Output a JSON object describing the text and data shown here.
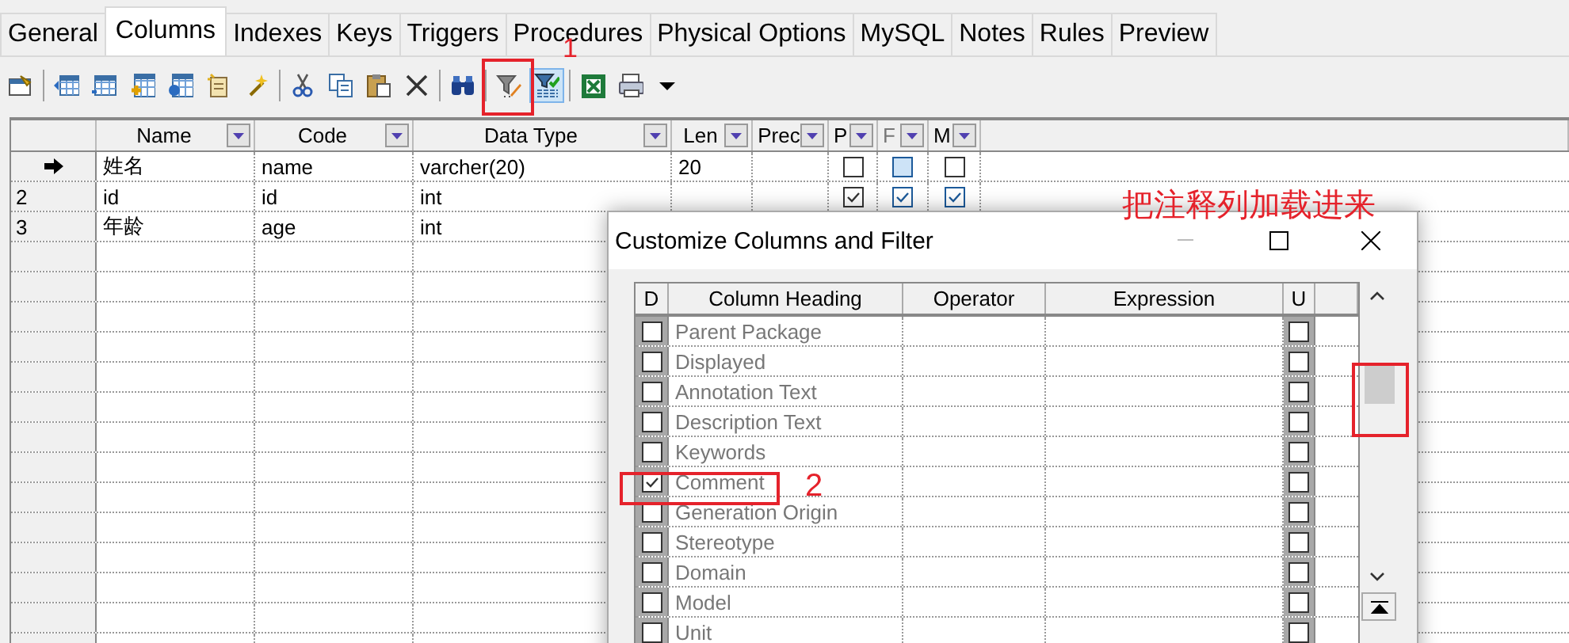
{
  "tabs": [
    {
      "label": "General",
      "selected": false
    },
    {
      "label": "Columns",
      "selected": true
    },
    {
      "label": "Indexes",
      "selected": false
    },
    {
      "label": "Keys",
      "selected": false
    },
    {
      "label": "Triggers",
      "selected": false
    },
    {
      "label": "Procedures",
      "selected": false
    },
    {
      "label": "Physical Options",
      "selected": false
    },
    {
      "label": "MySQL",
      "selected": false
    },
    {
      "label": "Notes",
      "selected": false
    },
    {
      "label": "Rules",
      "selected": false
    },
    {
      "label": "Preview",
      "selected": false
    }
  ],
  "toolbar": [
    {
      "kind": "properties",
      "pressed": false
    },
    {
      "kind": "separator"
    },
    {
      "kind": "insert-row",
      "pressed": false
    },
    {
      "kind": "add-row",
      "pressed": false
    },
    {
      "kind": "add-columns",
      "pressed": false
    },
    {
      "kind": "reuse-columns",
      "pressed": false
    },
    {
      "kind": "new-sheet",
      "pressed": false
    },
    {
      "kind": "wand",
      "pressed": false
    },
    {
      "kind": "separator"
    },
    {
      "kind": "cut",
      "pressed": false
    },
    {
      "kind": "copy",
      "pressed": false
    },
    {
      "kind": "paste",
      "pressed": false
    },
    {
      "kind": "delete",
      "pressed": false
    },
    {
      "kind": "separator"
    },
    {
      "kind": "find",
      "pressed": false
    },
    {
      "kind": "separator"
    },
    {
      "kind": "filter-edit",
      "pressed": false
    },
    {
      "kind": "filter-check",
      "pressed": true
    },
    {
      "kind": "separator"
    },
    {
      "kind": "excel",
      "pressed": false
    },
    {
      "kind": "print",
      "pressed": false
    },
    {
      "kind": "dropdown",
      "pressed": false
    }
  ],
  "grid": {
    "columns": [
      {
        "title": "Name",
        "kind": "text",
        "disabled": false
      },
      {
        "title": "Code",
        "kind": "text",
        "disabled": false
      },
      {
        "title": "Data Type",
        "kind": "text",
        "disabled": false
      },
      {
        "title": "Len",
        "kind": "text",
        "disabled": false
      },
      {
        "title": "Prec",
        "kind": "text",
        "disabled": false
      },
      {
        "title": "P",
        "kind": "check",
        "disabled": false
      },
      {
        "title": "F",
        "kind": "check",
        "disabled": true
      },
      {
        "title": "M",
        "kind": "check",
        "disabled": false
      }
    ],
    "rows": [
      {
        "number": "",
        "current": true,
        "cells": [
          "姓名",
          "name",
          "varcher(20)",
          "20",
          "",
          false,
          false,
          false
        ]
      },
      {
        "number": "2",
        "current": false,
        "cells": [
          "id",
          "id",
          "int",
          "",
          "",
          true,
          true,
          true
        ]
      },
      {
        "number": "3",
        "current": false,
        "cells": [
          "年龄",
          "age",
          "int"
        ]
      }
    ]
  },
  "dialog": {
    "title": "Customize Columns and Filter",
    "columns": [
      "D",
      "Column Heading",
      "Operator",
      "Expression",
      "U"
    ],
    "rows": [
      {
        "heading": "Parent Package",
        "displayed": false,
        "u": false
      },
      {
        "heading": "Displayed",
        "displayed": false,
        "u": false
      },
      {
        "heading": "Annotation Text",
        "displayed": false,
        "u": false
      },
      {
        "heading": "Description Text",
        "displayed": false,
        "u": false
      },
      {
        "heading": "Keywords",
        "displayed": false,
        "u": false
      },
      {
        "heading": "Comment",
        "displayed": true,
        "u": false
      },
      {
        "heading": "Generation Origin",
        "displayed": false,
        "u": false
      },
      {
        "heading": "Stereotype",
        "displayed": false,
        "u": false
      },
      {
        "heading": "Domain",
        "displayed": false,
        "u": false
      },
      {
        "heading": "Model",
        "displayed": false,
        "u": false
      },
      {
        "heading": "Unit",
        "displayed": false,
        "u": false
      }
    ]
  },
  "annotations": {
    "step_1": "1",
    "step_2": "2",
    "note": "把注释列加载进来"
  }
}
